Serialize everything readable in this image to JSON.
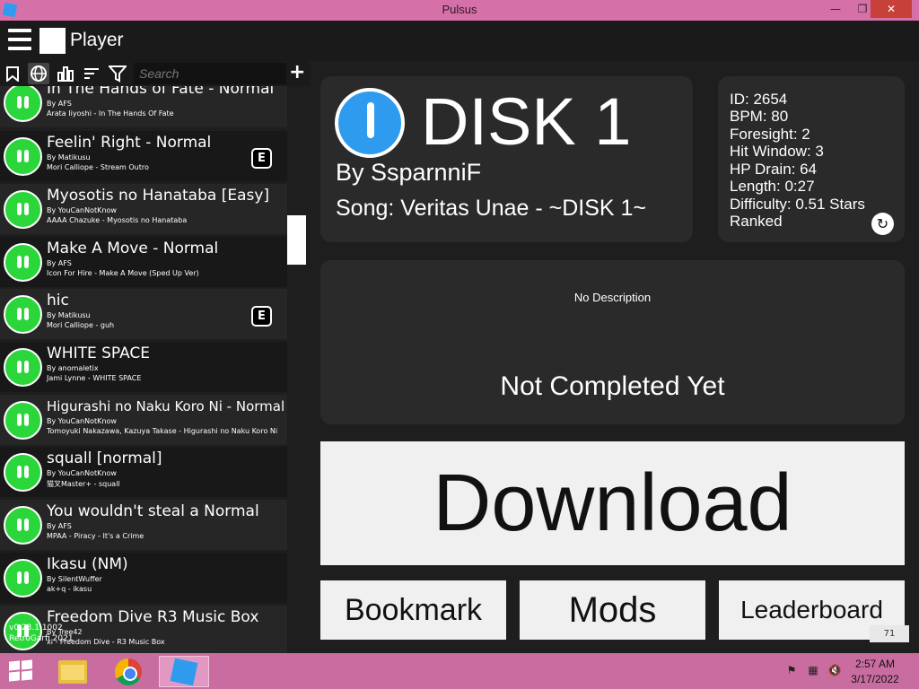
{
  "window": {
    "title": "Pulsus",
    "minimize": "—",
    "maximize": "❐",
    "close": "✕"
  },
  "header": {
    "label": "Player"
  },
  "toolbar": {
    "search_placeholder": "Search",
    "bookmark_icon": "🔖",
    "globe_icon": "🌐",
    "chart_icon": "📊",
    "sort_icon": "≡",
    "filter_icon": "⛉",
    "add_icon": "+"
  },
  "songs": [
    {
      "title": "In The Hands of Fate - Normal",
      "mapper": "By AFS",
      "source": "Arata Iiyoshi - In The Hands Of Fate",
      "badge": ""
    },
    {
      "title": "Feelin' Right - Normal",
      "mapper": "By Matikusu",
      "source": "Mori Calliope - Stream Outro",
      "badge": "E"
    },
    {
      "title": "Myosotis no Hanataba [Easy]",
      "mapper": "By YouCanNotKnow",
      "source": "AAAA Chazuke - Myosotis no Hanataba",
      "badge": ""
    },
    {
      "title": "Make A Move - Normal",
      "mapper": "By AFS",
      "source": "Icon For Hire - Make A Move (Sped Up Ver)",
      "badge": ""
    },
    {
      "title": "hic",
      "mapper": "By Matikusu",
      "source": "Mori Calliope - guh",
      "badge": "E"
    },
    {
      "title": "WHITE SPACE",
      "mapper": "By anomaletix",
      "source": "Jami Lynne - WHITE SPACE",
      "badge": ""
    },
    {
      "title": "Higurashi no Naku Koro Ni - Normal",
      "mapper": "By YouCanNotKnow",
      "source": "Tomoyuki Nakazawa, Kazuya Takase - Higurashi no Naku Koro Ni",
      "badge": ""
    },
    {
      "title": "squall [normal]",
      "mapper": "By YouCanNotKnow",
      "source": "猫叉Master+ - squall",
      "badge": ""
    },
    {
      "title": "You wouldn't steal a Normal",
      "mapper": "By AFS",
      "source": "MPAA - Piracy - It's a Crime",
      "badge": ""
    },
    {
      "title": "Ikasu (NM)",
      "mapper": "By SilentWuffer",
      "source": "ak+q - ikasu",
      "badge": ""
    },
    {
      "title": "Freedom Dive R3 Music Box",
      "mapper": "By Tree42",
      "source": "xi - Freedom Dive - R3 Music Box",
      "badge": ""
    }
  ],
  "version": {
    "line1": "v0.23.1.1002",
    "line2": "RetroGarfi 2021"
  },
  "map": {
    "title": "DISK 1",
    "by": "By SsparnniF",
    "song": "Song: Veritas Unae - ~DISK 1~"
  },
  "stats": {
    "id": "ID: 2654",
    "bpm": "BPM: 80",
    "foresight": "Foresight: 2",
    "hit_window": "Hit Window: 3",
    "hp_drain": "HP Drain: 64",
    "length": "Length: 0:27",
    "difficulty": "Difficulty: 0.51 Stars",
    "status": "Ranked"
  },
  "description": "No Description",
  "completion": "Not Completed Yet",
  "actions": {
    "download": "Download",
    "bookmark": "Bookmark",
    "mods": "Mods",
    "leaderboard": "Leaderboard"
  },
  "page_counter": "71",
  "taskbar": {
    "time": "2:57 AM",
    "date": "3/17/2022"
  },
  "colors": {
    "accent_green": "#2ad63a",
    "accent_blue": "#2e9bef",
    "titlebar": "#d670a8",
    "taskbar": "#c96da0"
  }
}
